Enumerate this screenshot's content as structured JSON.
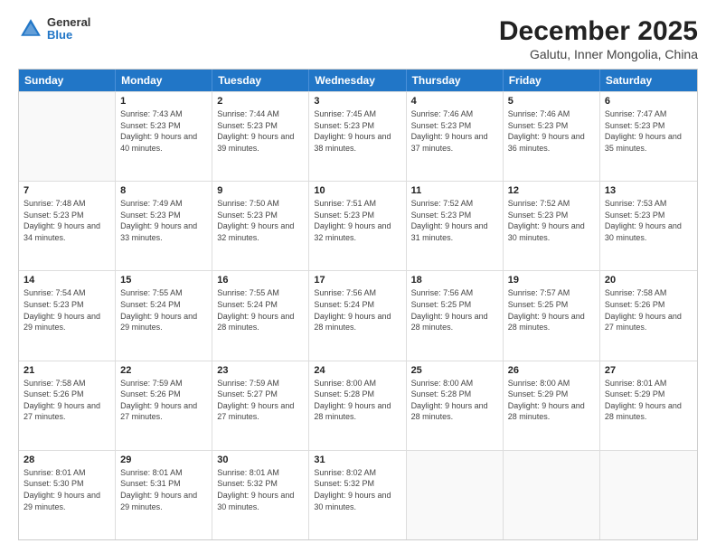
{
  "logo": {
    "general": "General",
    "blue": "Blue"
  },
  "header": {
    "title": "December 2025",
    "subtitle": "Galutu, Inner Mongolia, China"
  },
  "days": [
    "Sunday",
    "Monday",
    "Tuesday",
    "Wednesday",
    "Thursday",
    "Friday",
    "Saturday"
  ],
  "weeks": [
    [
      {
        "day": "",
        "sunrise": "",
        "sunset": "",
        "daylight": ""
      },
      {
        "day": "1",
        "sunrise": "Sunrise: 7:43 AM",
        "sunset": "Sunset: 5:23 PM",
        "daylight": "Daylight: 9 hours and 40 minutes."
      },
      {
        "day": "2",
        "sunrise": "Sunrise: 7:44 AM",
        "sunset": "Sunset: 5:23 PM",
        "daylight": "Daylight: 9 hours and 39 minutes."
      },
      {
        "day": "3",
        "sunrise": "Sunrise: 7:45 AM",
        "sunset": "Sunset: 5:23 PM",
        "daylight": "Daylight: 9 hours and 38 minutes."
      },
      {
        "day": "4",
        "sunrise": "Sunrise: 7:46 AM",
        "sunset": "Sunset: 5:23 PM",
        "daylight": "Daylight: 9 hours and 37 minutes."
      },
      {
        "day": "5",
        "sunrise": "Sunrise: 7:46 AM",
        "sunset": "Sunset: 5:23 PM",
        "daylight": "Daylight: 9 hours and 36 minutes."
      },
      {
        "day": "6",
        "sunrise": "Sunrise: 7:47 AM",
        "sunset": "Sunset: 5:23 PM",
        "daylight": "Daylight: 9 hours and 35 minutes."
      }
    ],
    [
      {
        "day": "7",
        "sunrise": "Sunrise: 7:48 AM",
        "sunset": "Sunset: 5:23 PM",
        "daylight": "Daylight: 9 hours and 34 minutes."
      },
      {
        "day": "8",
        "sunrise": "Sunrise: 7:49 AM",
        "sunset": "Sunset: 5:23 PM",
        "daylight": "Daylight: 9 hours and 33 minutes."
      },
      {
        "day": "9",
        "sunrise": "Sunrise: 7:50 AM",
        "sunset": "Sunset: 5:23 PM",
        "daylight": "Daylight: 9 hours and 32 minutes."
      },
      {
        "day": "10",
        "sunrise": "Sunrise: 7:51 AM",
        "sunset": "Sunset: 5:23 PM",
        "daylight": "Daylight: 9 hours and 32 minutes."
      },
      {
        "day": "11",
        "sunrise": "Sunrise: 7:52 AM",
        "sunset": "Sunset: 5:23 PM",
        "daylight": "Daylight: 9 hours and 31 minutes."
      },
      {
        "day": "12",
        "sunrise": "Sunrise: 7:52 AM",
        "sunset": "Sunset: 5:23 PM",
        "daylight": "Daylight: 9 hours and 30 minutes."
      },
      {
        "day": "13",
        "sunrise": "Sunrise: 7:53 AM",
        "sunset": "Sunset: 5:23 PM",
        "daylight": "Daylight: 9 hours and 30 minutes."
      }
    ],
    [
      {
        "day": "14",
        "sunrise": "Sunrise: 7:54 AM",
        "sunset": "Sunset: 5:23 PM",
        "daylight": "Daylight: 9 hours and 29 minutes."
      },
      {
        "day": "15",
        "sunrise": "Sunrise: 7:55 AM",
        "sunset": "Sunset: 5:24 PM",
        "daylight": "Daylight: 9 hours and 29 minutes."
      },
      {
        "day": "16",
        "sunrise": "Sunrise: 7:55 AM",
        "sunset": "Sunset: 5:24 PM",
        "daylight": "Daylight: 9 hours and 28 minutes."
      },
      {
        "day": "17",
        "sunrise": "Sunrise: 7:56 AM",
        "sunset": "Sunset: 5:24 PM",
        "daylight": "Daylight: 9 hours and 28 minutes."
      },
      {
        "day": "18",
        "sunrise": "Sunrise: 7:56 AM",
        "sunset": "Sunset: 5:25 PM",
        "daylight": "Daylight: 9 hours and 28 minutes."
      },
      {
        "day": "19",
        "sunrise": "Sunrise: 7:57 AM",
        "sunset": "Sunset: 5:25 PM",
        "daylight": "Daylight: 9 hours and 28 minutes."
      },
      {
        "day": "20",
        "sunrise": "Sunrise: 7:58 AM",
        "sunset": "Sunset: 5:26 PM",
        "daylight": "Daylight: 9 hours and 27 minutes."
      }
    ],
    [
      {
        "day": "21",
        "sunrise": "Sunrise: 7:58 AM",
        "sunset": "Sunset: 5:26 PM",
        "daylight": "Daylight: 9 hours and 27 minutes."
      },
      {
        "day": "22",
        "sunrise": "Sunrise: 7:59 AM",
        "sunset": "Sunset: 5:26 PM",
        "daylight": "Daylight: 9 hours and 27 minutes."
      },
      {
        "day": "23",
        "sunrise": "Sunrise: 7:59 AM",
        "sunset": "Sunset: 5:27 PM",
        "daylight": "Daylight: 9 hours and 27 minutes."
      },
      {
        "day": "24",
        "sunrise": "Sunrise: 8:00 AM",
        "sunset": "Sunset: 5:28 PM",
        "daylight": "Daylight: 9 hours and 28 minutes."
      },
      {
        "day": "25",
        "sunrise": "Sunrise: 8:00 AM",
        "sunset": "Sunset: 5:28 PM",
        "daylight": "Daylight: 9 hours and 28 minutes."
      },
      {
        "day": "26",
        "sunrise": "Sunrise: 8:00 AM",
        "sunset": "Sunset: 5:29 PM",
        "daylight": "Daylight: 9 hours and 28 minutes."
      },
      {
        "day": "27",
        "sunrise": "Sunrise: 8:01 AM",
        "sunset": "Sunset: 5:29 PM",
        "daylight": "Daylight: 9 hours and 28 minutes."
      }
    ],
    [
      {
        "day": "28",
        "sunrise": "Sunrise: 8:01 AM",
        "sunset": "Sunset: 5:30 PM",
        "daylight": "Daylight: 9 hours and 29 minutes."
      },
      {
        "day": "29",
        "sunrise": "Sunrise: 8:01 AM",
        "sunset": "Sunset: 5:31 PM",
        "daylight": "Daylight: 9 hours and 29 minutes."
      },
      {
        "day": "30",
        "sunrise": "Sunrise: 8:01 AM",
        "sunset": "Sunset: 5:32 PM",
        "daylight": "Daylight: 9 hours and 30 minutes."
      },
      {
        "day": "31",
        "sunrise": "Sunrise: 8:02 AM",
        "sunset": "Sunset: 5:32 PM",
        "daylight": "Daylight: 9 hours and 30 minutes."
      },
      {
        "day": "",
        "sunrise": "",
        "sunset": "",
        "daylight": ""
      },
      {
        "day": "",
        "sunrise": "",
        "sunset": "",
        "daylight": ""
      },
      {
        "day": "",
        "sunrise": "",
        "sunset": "",
        "daylight": ""
      }
    ]
  ]
}
